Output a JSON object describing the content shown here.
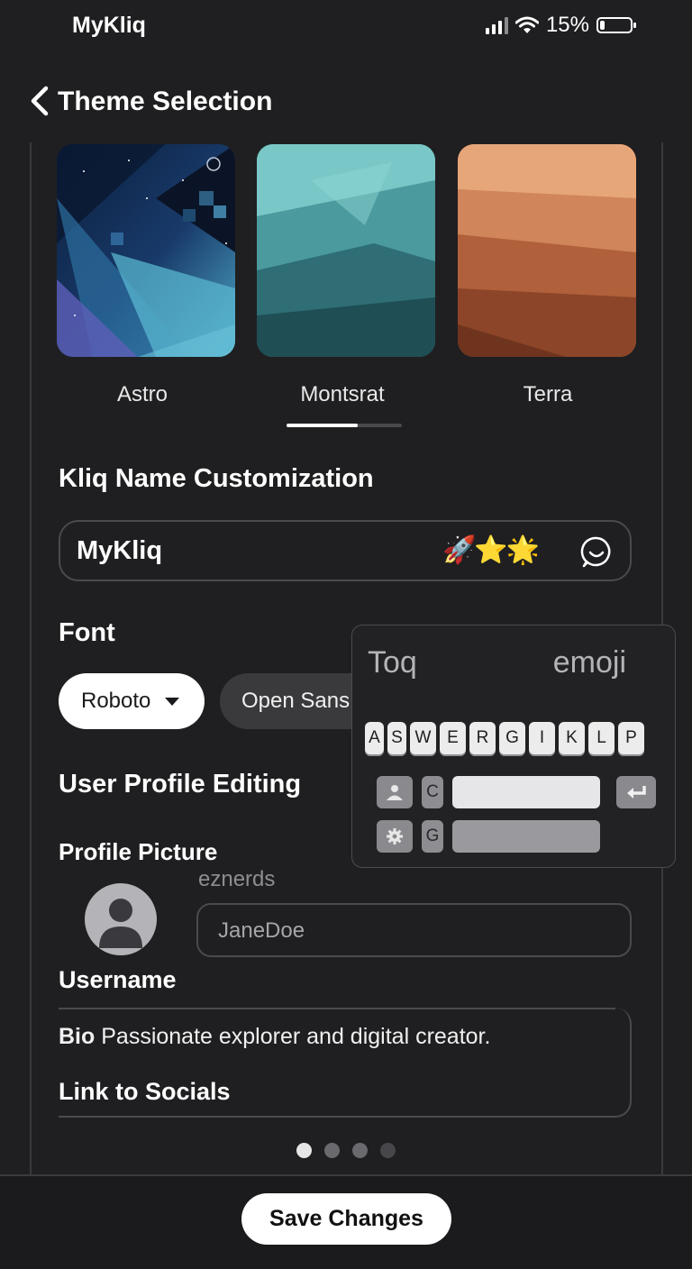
{
  "status_bar": {
    "app_title": "MyKliq",
    "battery_text": "15%",
    "battery_level": 0.15,
    "icons": [
      "signal-icon",
      "wifi-icon",
      "battery-icon"
    ]
  },
  "header": {
    "title": "Theme Selection",
    "back_icon": "chevron-left-icon"
  },
  "themes": {
    "items": [
      {
        "label": "Astro"
      },
      {
        "label": "Montsrat"
      },
      {
        "label": "Terra"
      }
    ],
    "scroll_progress": 0.62
  },
  "name_section": {
    "heading": "Kliq Name Customization",
    "value": "MyKliq",
    "emojis": "🚀⭐🌟",
    "emoji_button_icon": "emoji-picker-icon"
  },
  "font_section": {
    "heading": "Font",
    "selected": "Roboto",
    "option": "Open Sans"
  },
  "keyboard": {
    "suggestion_left": "Toq",
    "suggestion_right": "emoji",
    "keys": [
      "A",
      "S",
      "W",
      "E",
      "R",
      "G",
      "I",
      "K",
      "L",
      "P"
    ],
    "row2_key": "C",
    "row3_key": "G",
    "icons": [
      "image-icon",
      "settings-icon",
      "return-icon"
    ]
  },
  "profile": {
    "heading": "User Profile Editing",
    "picture_label": "Profile Picture",
    "ghost_text": "eznerds",
    "username_placeholder": "JaneDoe",
    "username_label": "Username",
    "bio_label": "Bio",
    "bio_text": "Passionate explorer and digital creator.",
    "socials_label": "Link to Socials"
  },
  "pager": {
    "count": 4,
    "active_index": 0
  },
  "footer": {
    "save_label": "Save Changes"
  }
}
